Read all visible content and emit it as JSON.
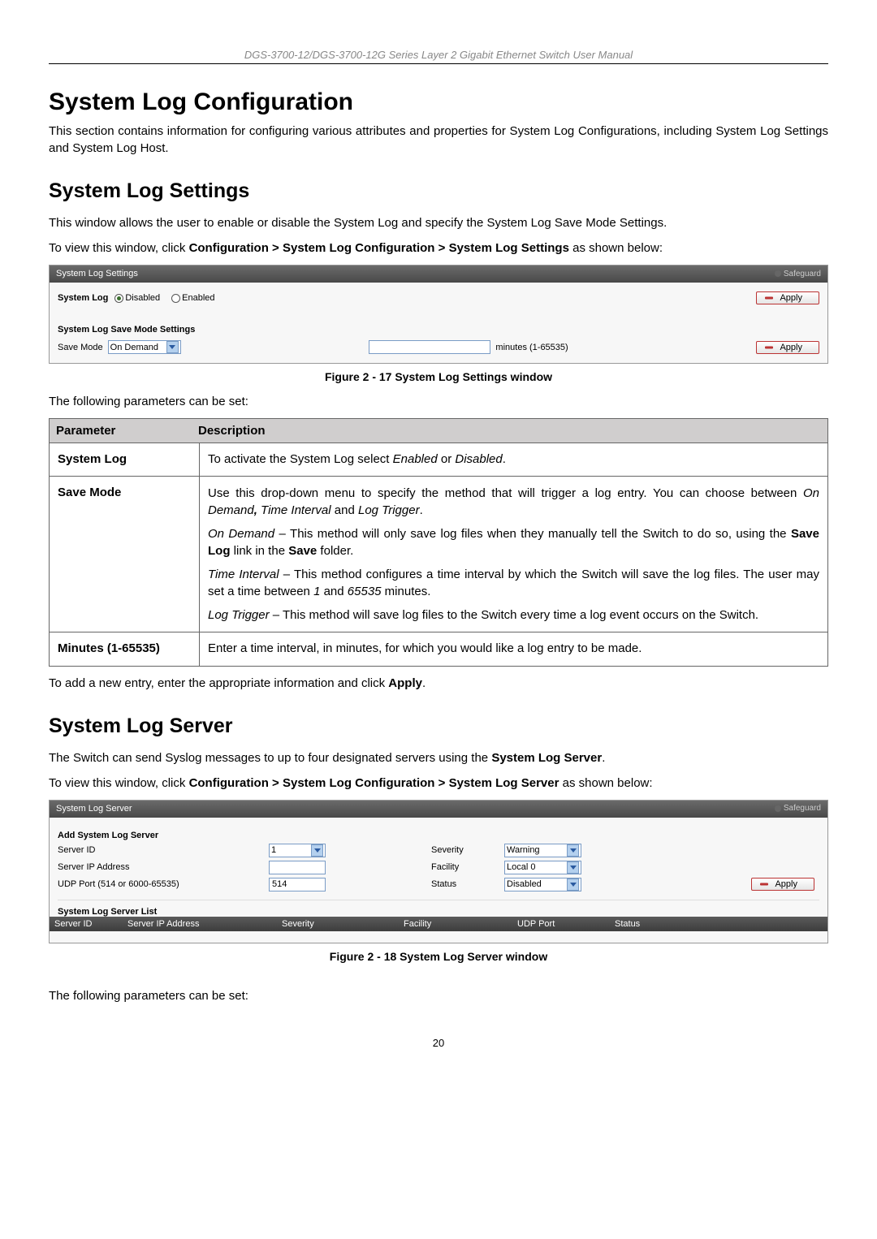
{
  "header": {
    "manual_title": "DGS-3700-12/DGS-3700-12G Series Layer 2 Gigabit Ethernet Switch User Manual"
  },
  "h1": "System Log Configuration",
  "intro": "This section contains information for configuring various attributes and properties for System Log Configurations, including System Log Settings and System Log Host.",
  "section1": {
    "title": "System Log Settings",
    "p1": "This window allows the user to enable or disable the System Log and specify the System Log Save Mode Settings.",
    "p2_prefix": "To view this window, click ",
    "p2_path": "Configuration > System Log Configuration > System Log Settings",
    "p2_suffix": " as shown below:"
  },
  "screenshot1": {
    "title": "System Log Settings",
    "safeguard": "Safeguard",
    "syslog_label": "System Log",
    "disabled": "Disabled",
    "enabled": "Enabled",
    "apply": "Apply",
    "save_mode_section": "System Log Save Mode Settings",
    "save_mode_label": "Save Mode",
    "save_mode_value": "On Demand",
    "minutes_hint": "minutes (1-65535)"
  },
  "fig1_caption": "Figure 2 - 17 System Log Settings window",
  "params_intro": "The following parameters can be set:",
  "param_header": {
    "param": "Parameter",
    "desc": "Description"
  },
  "params1": {
    "row1_name": "System Log",
    "row1_desc_a": "To activate the System Log select ",
    "row1_desc_b": "Enabled",
    "row1_desc_c": " or ",
    "row1_desc_d": "Disabled",
    "row1_desc_e": ".",
    "row2_name": "Save Mode",
    "row2_p1_a": "Use this drop-down menu to specify the method that will trigger a log entry. You can choose between ",
    "row2_p1_b": "On Demand",
    "row2_p1_c": ", ",
    "row2_p1_d": "Time Interval",
    "row2_p1_e": " and ",
    "row2_p1_f": "Log Trigger",
    "row2_p1_g": ".",
    "row2_p2_a": "On Demand",
    "row2_p2_b": " – This method will only save log files when they manually tell the Switch to do so, using the ",
    "row2_p2_c": "Save Log",
    "row2_p2_d": " link in the ",
    "row2_p2_e": "Save",
    "row2_p2_f": " folder.",
    "row2_p3_a": "Time Interval",
    "row2_p3_b": " – This method configures a time interval by which the Switch will save the log files. The user may set a time between ",
    "row2_p3_c": "1",
    "row2_p3_d": " and ",
    "row2_p3_e": "65535",
    "row2_p3_f": " minutes.",
    "row2_p4_a": "Log Trigger",
    "row2_p4_b": " – This method will save log files to the Switch every time a log event occurs on the Switch.",
    "row3_name": "Minutes (1-65535)",
    "row3_desc": "Enter a time interval, in minutes, for which you would like a log entry to be made."
  },
  "after_table1_a": "To add a new entry, enter the appropriate information and click ",
  "after_table1_b": "Apply",
  "after_table1_c": ".",
  "section2": {
    "title": "System Log Server",
    "p1_a": "The Switch can send Syslog messages to up to four designated servers using the ",
    "p1_b": "System Log Server",
    "p1_c": ".",
    "p2_prefix": "To view this window, click ",
    "p2_path": "Configuration > System Log Configuration > System Log Server",
    "p2_suffix": " as shown below:"
  },
  "screenshot2": {
    "title": "System Log Server",
    "safeguard": "Safeguard",
    "add_section": "Add System Log Server",
    "server_id_label": "Server ID",
    "server_id_value": "1",
    "server_ip_label": "Server IP Address",
    "server_ip_value": "",
    "udp_label": "UDP Port (514 or 6000-65535)",
    "udp_value": "514",
    "severity_label": "Severity",
    "severity_value": "Warning",
    "facility_label": "Facility",
    "facility_value": "Local 0",
    "status_label": "Status",
    "status_value": "Disabled",
    "apply": "Apply",
    "list_section": "System Log Server List",
    "list_cols": {
      "c1": "Server ID",
      "c2": "Server IP Address",
      "c3": "Severity",
      "c4": "Facility",
      "c5": "UDP Port",
      "c6": "Status"
    }
  },
  "fig2_caption": "Figure 2 - 18 System Log Server window",
  "params_intro2": "The following parameters can be set:",
  "page_number": "20"
}
